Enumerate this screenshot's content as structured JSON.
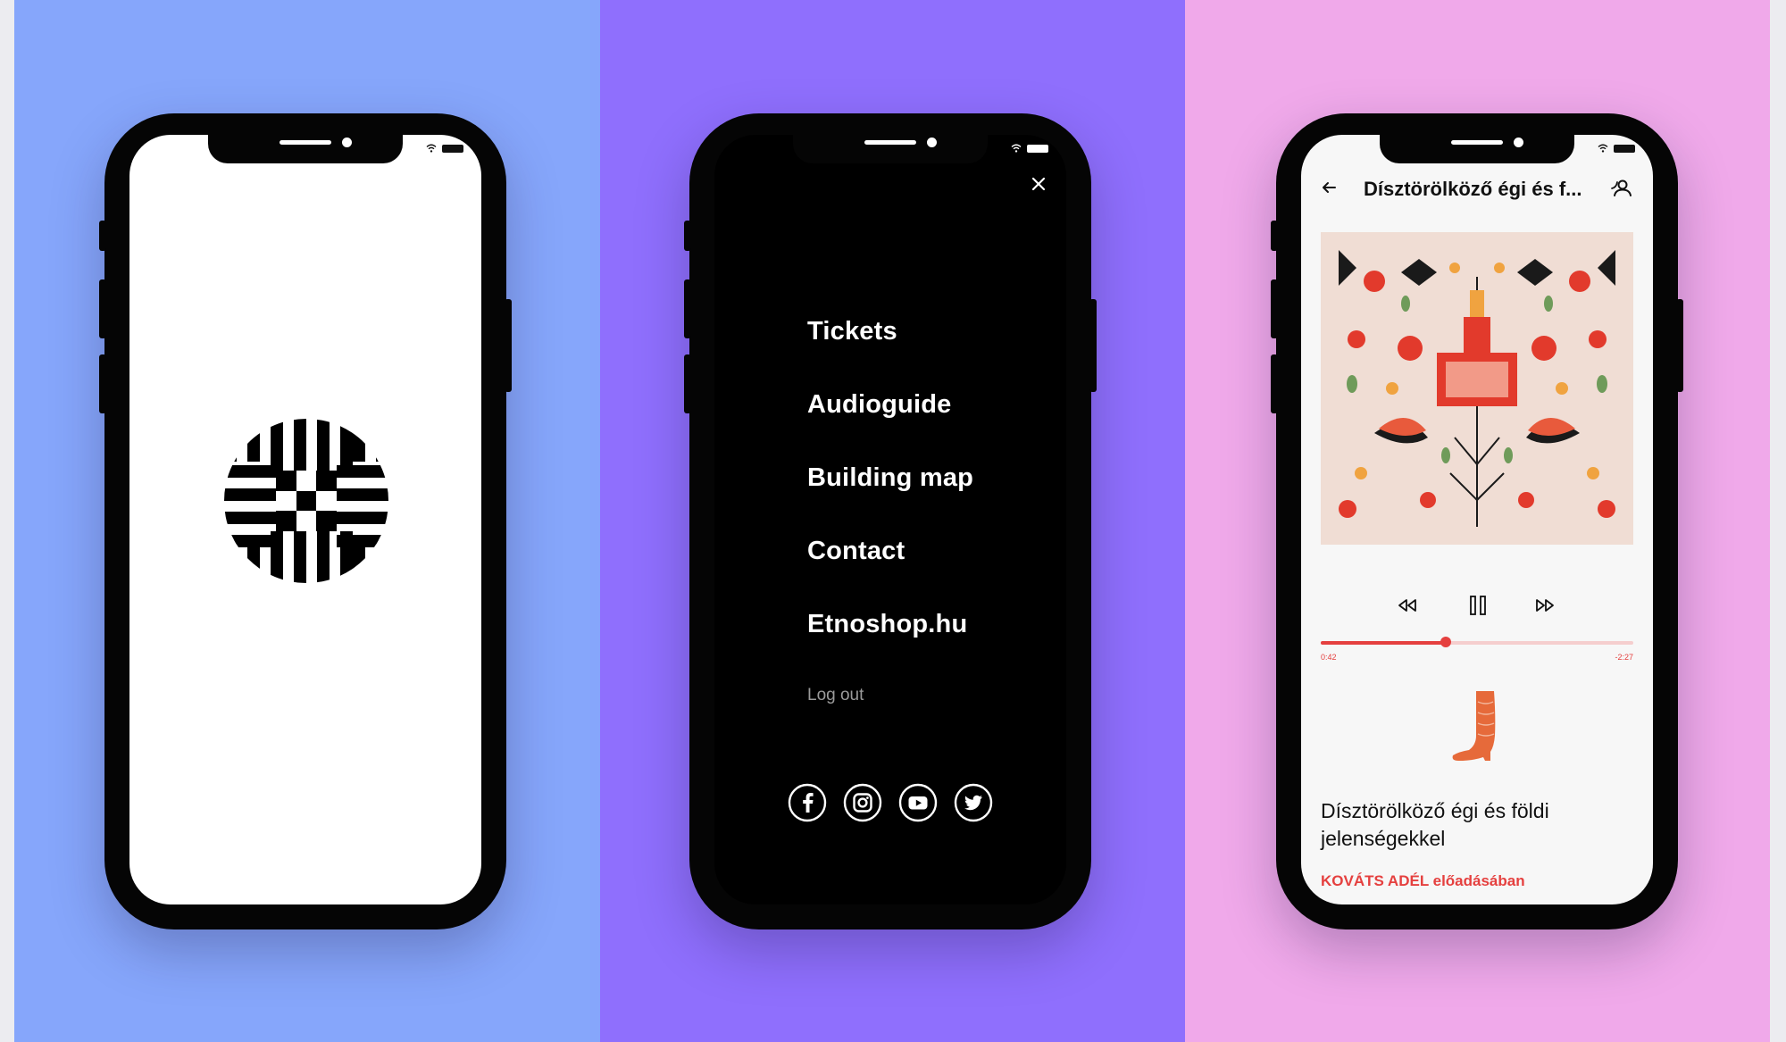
{
  "colors": {
    "panel_blue": "#86a6fb",
    "panel_purple": "#8f6ffd",
    "panel_pink": "#f0a9ea",
    "phone_frame": "#050505",
    "accent_red": "#e5403f"
  },
  "screen1": {
    "logo_icon": "ethnographic-museum-logo-icon"
  },
  "screen2": {
    "close_icon": "close-icon",
    "menu": [
      {
        "label": "Tickets"
      },
      {
        "label": "Audioguide"
      },
      {
        "label": "Building map"
      },
      {
        "label": "Contact"
      },
      {
        "label": "Etnoshop.hu"
      }
    ],
    "logout_label": "Log out",
    "social": [
      "facebook-icon",
      "instagram-icon",
      "youtube-icon",
      "twitter-icon"
    ]
  },
  "screen3": {
    "header": {
      "back_icon": "arrow-left-icon",
      "title": "Dísztörölköző égi és f...",
      "share_icon": "share-icon"
    },
    "controls": [
      "rewind-icon",
      "pause-icon",
      "fast-forward-icon"
    ],
    "progress": {
      "fraction": 0.4,
      "elapsed": "0:42",
      "remaining": "-2:27"
    },
    "track_title": "Dísztörölköző égi és földi jelenségekkel",
    "performer": "KOVÁTS ADÉL előadásában"
  }
}
